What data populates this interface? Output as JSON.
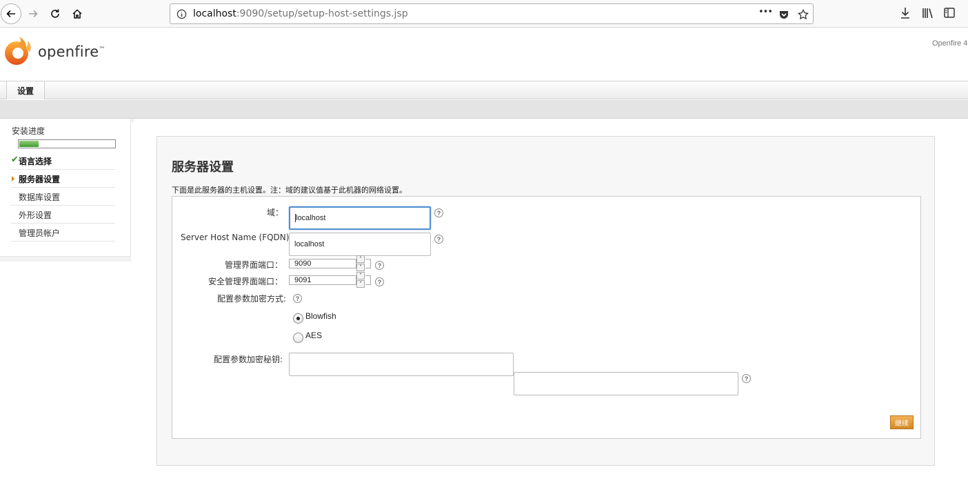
{
  "browser": {
    "url_host": "localhost",
    "url_rest": ":9090/setup/setup-host-settings.jsp",
    "more_label": "•••"
  },
  "header": {
    "logo_text": "openfire",
    "logo_tm": "™",
    "version": "Openfire 4."
  },
  "tabs": [
    {
      "label": "设置"
    }
  ],
  "sidebar": {
    "progress_title": "安装进度",
    "progress": 0.2,
    "steps": [
      {
        "label": "语言选择",
        "state": "done",
        "mark": "✔"
      },
      {
        "label": "服务器设置",
        "state": "current"
      },
      {
        "label": "数据库设置",
        "state": "pending"
      },
      {
        "label": "外形设置",
        "state": "pending"
      },
      {
        "label": "管理员帐户",
        "state": "pending"
      }
    ]
  },
  "main": {
    "title": "服务器设置",
    "intro": "下面是此服务器的主机设置。注：域的建议值基于此机器的网络设置。",
    "fields": {
      "domain_label": "域：",
      "domain_value": "localhost",
      "fqdn_label": "Server Host Name (FQDN):",
      "fqdn_value": "localhost",
      "admin_port_label": "管理界面端口：",
      "admin_port_value": "9090",
      "secure_port_label": "安全管理界面端口：",
      "secure_port_value": "9091",
      "encryption_label": "配置参数加密方式:",
      "radio_blowfish": "Blowfish",
      "radio_aes": "AES",
      "encryption_selected": "Blowfish",
      "key_label": "配置参数加密秘钥:",
      "key_value": "",
      "key_confirm_value": ""
    },
    "help_glyph": "?",
    "continue_label": "继续"
  },
  "colors": {
    "accent_orange": "#d48924",
    "progress_green": "#3f9a2c",
    "check_green": "#3a8a2a",
    "focus_blue": "#4f8fd0"
  }
}
